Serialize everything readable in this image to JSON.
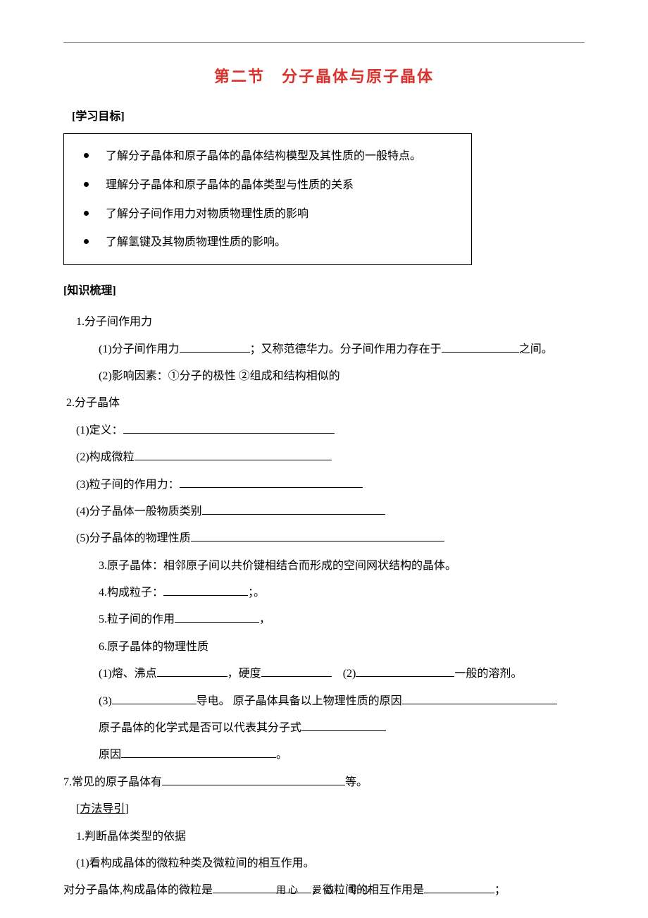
{
  "title": "第二节　分子晶体与原子晶体",
  "section_study_goals": {
    "heading": "[学习目标]",
    "bullets": [
      "了解分子晶体和原子晶体的晶体结构模型及其性质的一般特点。",
      "理解分子晶体和原子晶体的晶体类型与性质的关系",
      "了解分子间作用力对物质物理性质的影响",
      "了解氢键及其物质物理性质的影响。"
    ]
  },
  "section_knowledge": {
    "heading": "[知识梳理]",
    "item1": {
      "label": "1.分子间作用力",
      "sub1_prefix": "(1)分子间作用力",
      "sub1_mid": "；又称范德华力。分子间作用力存在于",
      "sub1_suffix": "之间。",
      "sub2": "(2)影响因素：①分子的极性 ②组成和结构相似的"
    },
    "item2": {
      "label": "2.分子晶体",
      "sub1": "(1)定义：",
      "sub2": "(2)构成微粒",
      "sub3": "(3)粒子间的作用力：",
      "sub4": "(4)分子晶体一般物质类别",
      "sub5": "(5)分子晶体的物理性质"
    },
    "item3": "3.原子晶体：相邻原子间以共价键相结合而形成的空间网状结构的晶体。",
    "item4_prefix": "4.构成粒子：",
    "item4_suffix": "；。",
    "item5_prefix": "5.粒子间的作用",
    "item5_suffix": "，",
    "item6": {
      "label": "6.原子晶体的物理性质",
      "line1_a": "(1)熔、沸点",
      "line1_b": "，硬度",
      "line1_c": "(2)",
      "line1_d": "一般的溶剂。",
      "line2_a": "(3)",
      "line2_b": "导电。 原子晶体具备以上物理性质的原因",
      "line3": "原子晶体的化学式是否可以代表其分子式",
      "line4_a": "原因",
      "line4_b": "。"
    },
    "item7_a": "7.常见的原子晶体有",
    "item7_b": "等。"
  },
  "section_method": {
    "heading": "[方法导引]",
    "line1": "1.判断晶体类型的依据",
    "line2": "(1)看构成晶体的微粒种类及微粒间的相互作用。",
    "line3_a": "对分子晶体,构成晶体的微粒是",
    "line3_b": "，微粒间的相互作用是",
    "line3_c": "；"
  },
  "footer": "用心　爱心　专心"
}
